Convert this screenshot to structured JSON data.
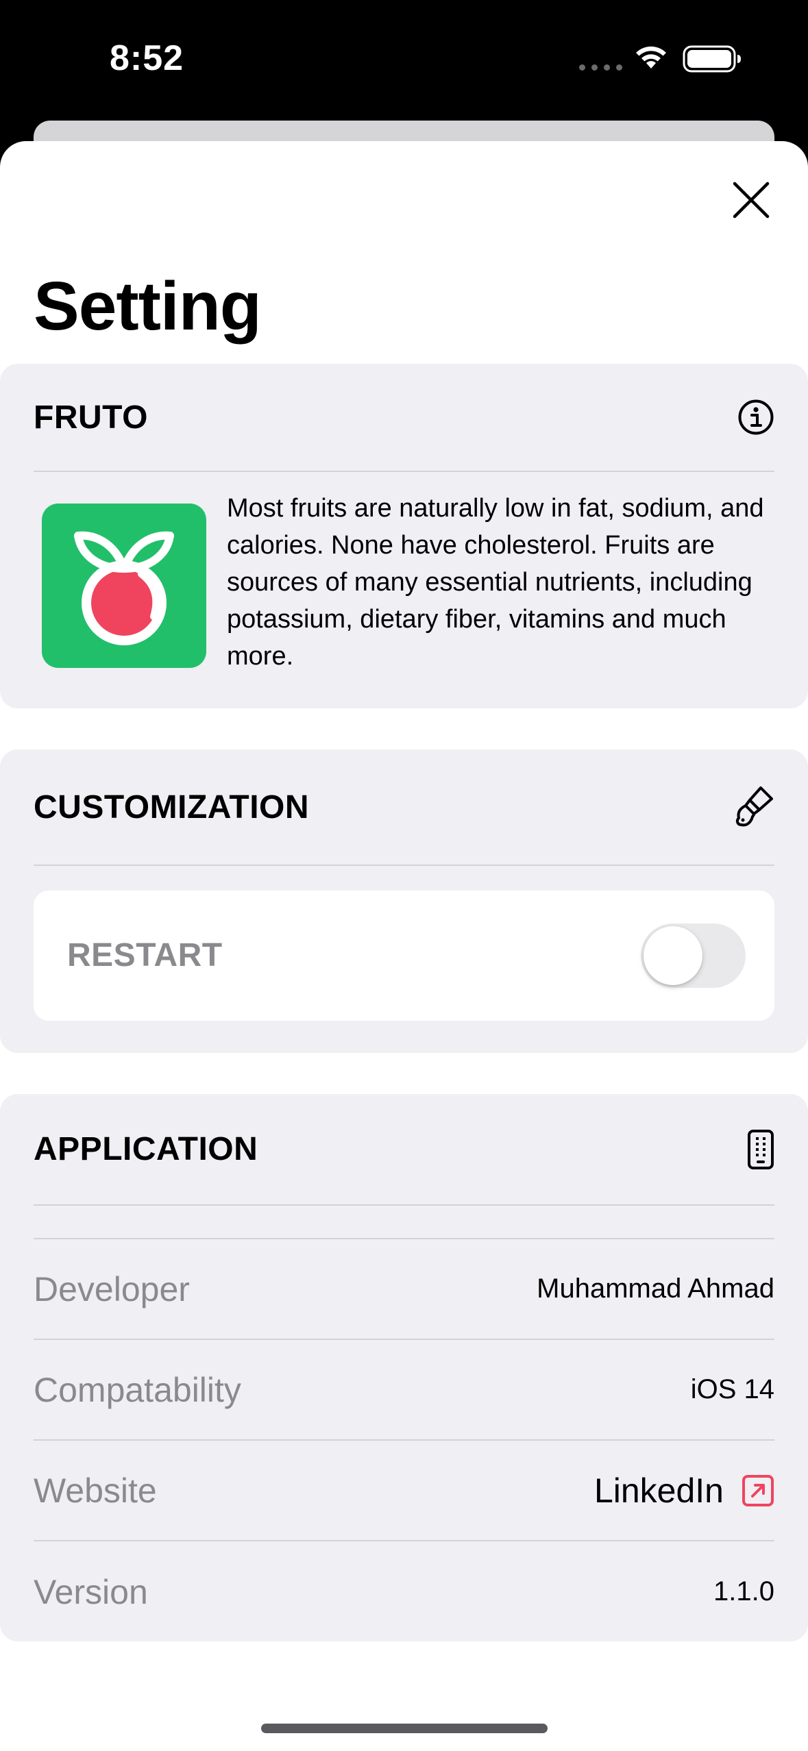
{
  "status_bar": {
    "time": "8:52",
    "icons": [
      "cellular-dots-icon",
      "wifi-icon",
      "battery-icon"
    ]
  },
  "page": {
    "title": "Setting"
  },
  "colors": {
    "accent_pink": "#f0445e",
    "brand_green": "#22bf6b",
    "card_bg": "#efeff4",
    "secondary_text": "#8a8a8e"
  },
  "fruto": {
    "title": "FRUTO",
    "icon": "info-circle-icon",
    "logo": "fruto-logo",
    "description": "Most fruits are naturally low in fat, sodium, and calories. None have cholesterol. Fruits are sources of many essential nutrients, including potassium, dietary fiber, vitamins and much more."
  },
  "customization": {
    "title": "CUSTOMIZATION",
    "icon": "paintbrush-icon",
    "restart_label": "RESTART",
    "restart_on": false
  },
  "application": {
    "title": "APPLICATION",
    "icon": "iphone-icon",
    "rows": [
      {
        "label": "Developer",
        "value": "Muhammad Ahmad"
      },
      {
        "label": "Compatability",
        "value": "iOS 14"
      },
      {
        "label": "Website",
        "value": "LinkedIn",
        "link_icon": "external-link-icon"
      },
      {
        "label": "Version",
        "value": "1.1.0"
      }
    ]
  }
}
